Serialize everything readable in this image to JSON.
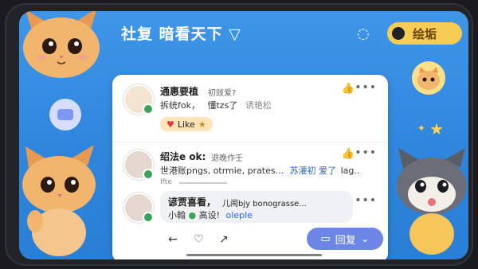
{
  "header": {
    "title": "社复 暗看天下 ▽",
    "status_pill_label": "绘垢"
  },
  "comments": [
    {
      "name": "通惠要植",
      "meta": "初豉爱?",
      "line1": "拆统fok，",
      "line2": "懂tzs了",
      "line3": "诱艳松",
      "like_label": "Like"
    },
    {
      "name": "绍法e ok:",
      "meta": "退晚作壬",
      "line1": "世港账pngs, otrmie, prates...",
      "link": "苏灌初 爱了",
      "line1_end": "lag..",
      "line2": "Ifte"
    },
    {
      "name": "谚贾喜看，",
      "meta": "儿闹bjy bonograsse...",
      "line1": "小翰",
      "line1b": "高设!",
      "link": "oleple"
    }
  ],
  "reply": {
    "label": "回复"
  },
  "icons": {
    "thumb": "thumbs-up-icon",
    "more": "more-dots-icon"
  }
}
